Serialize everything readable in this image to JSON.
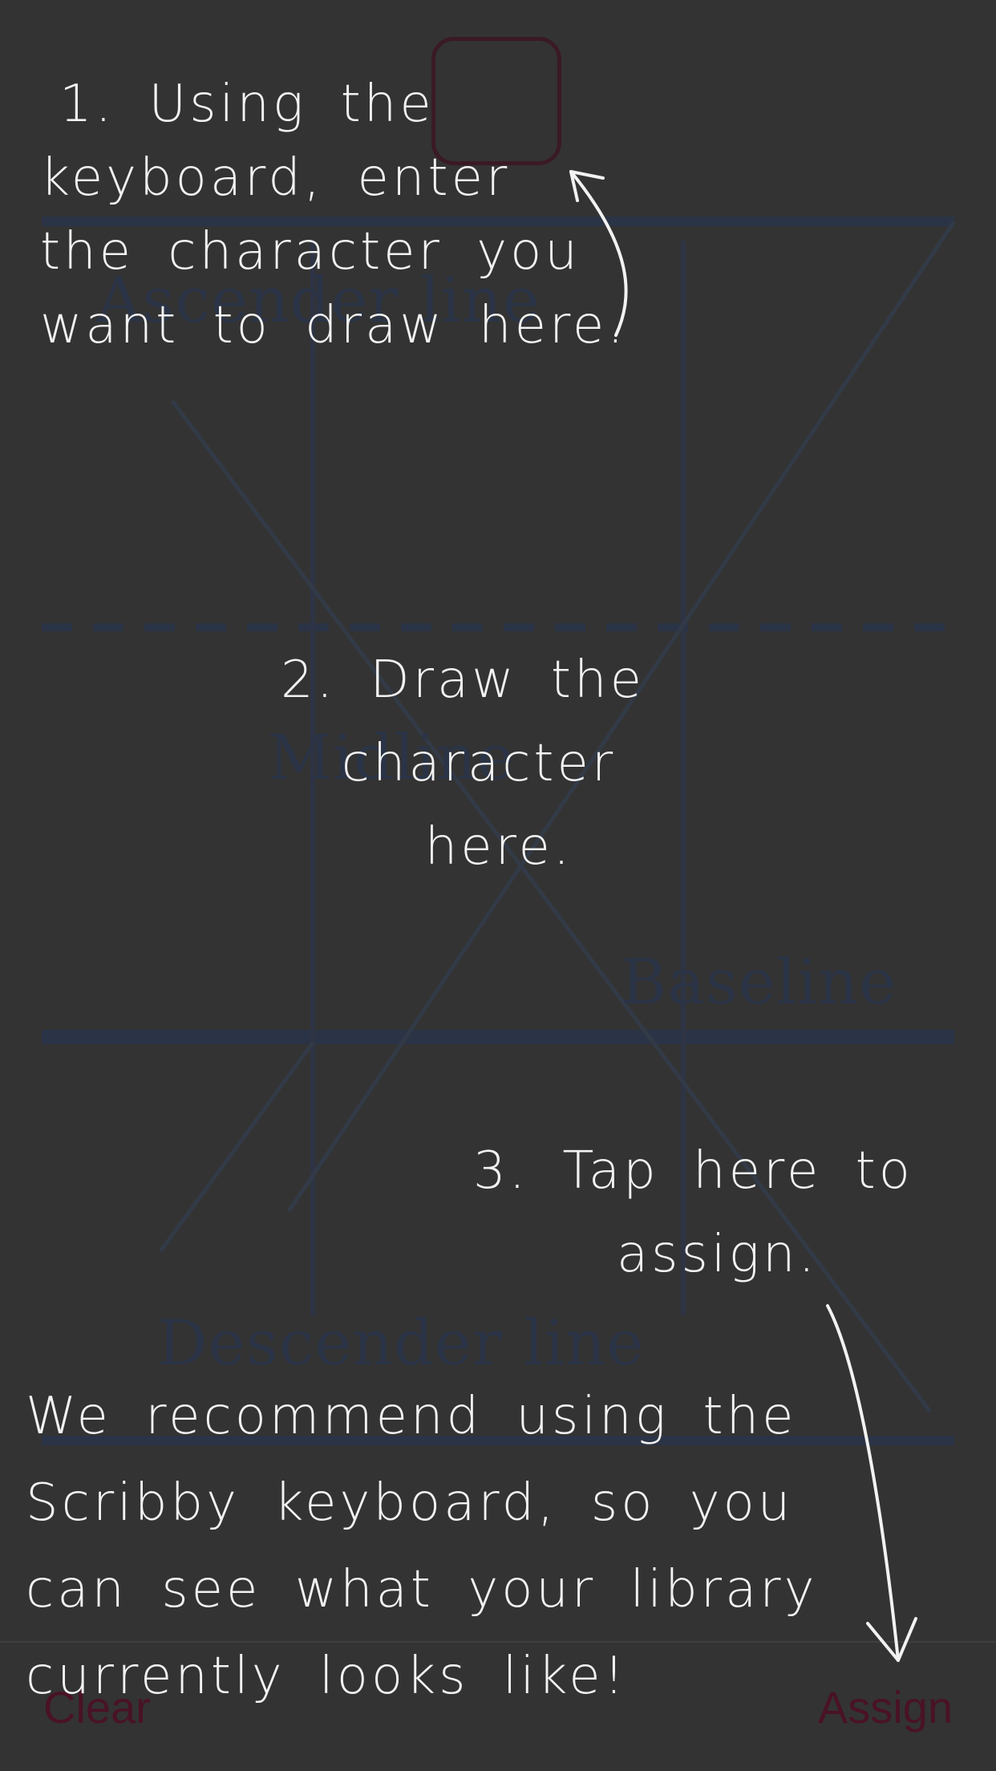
{
  "guides": {
    "ascender_label": "Ascender line",
    "midline_label": "Midline",
    "baseline_label": "Baseline",
    "descender_label": "Descender line"
  },
  "char_input": {
    "value": ""
  },
  "instructions": {
    "step1": [
      "1. Using the",
      "keyboard, enter",
      "the character you",
      "want to draw here."
    ],
    "step2": [
      "2. Draw the",
      "character",
      "here."
    ],
    "step3": [
      "3. Tap here to",
      "assign."
    ],
    "recommend": [
      "We recommend using the",
      "Scribby keyboard, so you",
      "can see what your library",
      "currently looks like!"
    ]
  },
  "bottom_bar": {
    "clear_label": "Clear",
    "assign_label": "Assign"
  },
  "colors": {
    "background": "#333333",
    "guide_line": "#2b3446",
    "accent": "#4a1226",
    "overlay_text": "#f2f2f2"
  }
}
